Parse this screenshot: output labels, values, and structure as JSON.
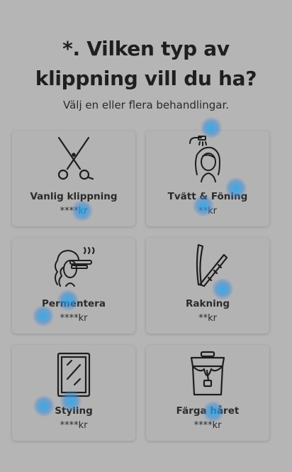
{
  "heading": {
    "line1": "*. Vilken typ av",
    "line2": "klippning vill du ha?"
  },
  "subheading": "Välj en eller flera behandlingar.",
  "services": [
    {
      "label": "Vanlig klippning",
      "price": "****kr",
      "icon": "scissors-icon"
    },
    {
      "label": "Tvätt & Föning",
      "price": "**kr",
      "icon": "hair-wash-icon"
    },
    {
      "label": "Permentera",
      "price": "****kr",
      "icon": "perm-curling-iron-icon"
    },
    {
      "label": "Rakning",
      "price": "**kr",
      "icon": "razor-icon"
    },
    {
      "label": "Styling",
      "price": "****kr",
      "icon": "mirror-icon"
    },
    {
      "label": "Färga håret",
      "price": "****kr",
      "icon": "paint-bucket-icon"
    }
  ],
  "colors": {
    "background": "#b5b5b5",
    "card": "#b3b3b3",
    "text": "#1f1f1f",
    "heat": "#1eaaf0"
  }
}
